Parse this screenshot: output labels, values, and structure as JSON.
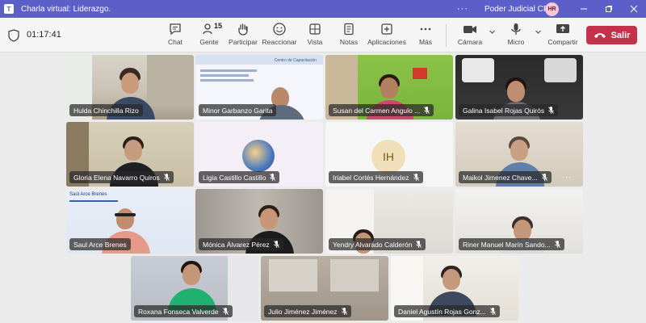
{
  "window": {
    "title": "Charla virtual: Liderazgo.",
    "org": "Poder Judicial CR",
    "user_initials": "HR",
    "more": "···"
  },
  "toolbar": {
    "timer": "01:17:41",
    "chat": "Chat",
    "people": "Gente",
    "people_count": "15",
    "raise": "Participar",
    "react": "Reaccionar",
    "view": "Vista",
    "notes": "Notas",
    "apps": "Aplicaciones",
    "more": "Más",
    "camera": "Cámara",
    "mic": "Micro",
    "share": "Compartir",
    "leave": "Salir"
  },
  "accent": "#5b5fc7",
  "leave_color": "#c4314b",
  "participants": [
    {
      "name": "Hulda Chinchilla Rizo"
    },
    {
      "name": "Minor Garbanzo Garita"
    },
    {
      "name": "Susan del Carmen Angulo ..."
    },
    {
      "name": "Galina Isabel Rojas Quirós"
    },
    {
      "name": "Gloria Elena Navarro Quiros"
    },
    {
      "name": "Ligia Castillo Castillo"
    },
    {
      "name": "Iriabel Cortés Hernández",
      "initials": "IH"
    },
    {
      "name": "Maikol Jimenez Chave..."
    },
    {
      "name": "Saul Arce Brenes"
    },
    {
      "name": "Mónica Álvarez Pérez"
    },
    {
      "name": "Yendry Alvarado Calderón"
    },
    {
      "name": "Riner Manuel Marín Sando..."
    },
    {
      "name": "Roxana Fonseca Valverde"
    },
    {
      "name": "Julio Jiménez Jiménez"
    },
    {
      "name": "Daniel Agustín Rojas Gonz..."
    }
  ],
  "slide": {
    "title": "Centro de Capacitación",
    "badge_name": "Saúl Arce Brenes"
  },
  "tile_more": "···"
}
